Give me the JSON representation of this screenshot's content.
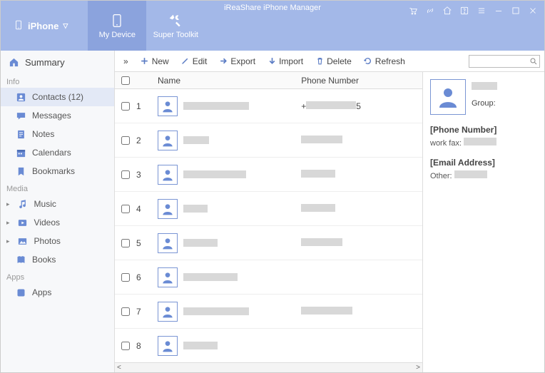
{
  "app_title": "iReaShare iPhone Manager",
  "device_selector": {
    "label": "iPhone"
  },
  "header_tabs": {
    "my_device": "My Device",
    "super_toolkit": "Super Toolkit"
  },
  "sidebar": {
    "summary": "Summary",
    "groups": {
      "info": {
        "label": "Info",
        "items": [
          {
            "label": "Contacts  (12)",
            "icon": "contacts",
            "active": true
          },
          {
            "label": "Messages",
            "icon": "messages"
          },
          {
            "label": "Notes",
            "icon": "notes"
          },
          {
            "label": "Calendars",
            "icon": "calendars"
          },
          {
            "label": "Bookmarks",
            "icon": "bookmarks"
          }
        ]
      },
      "media": {
        "label": "Media",
        "items": [
          {
            "label": "Music",
            "icon": "music",
            "arrow": true
          },
          {
            "label": "Videos",
            "icon": "videos",
            "arrow": true
          },
          {
            "label": "Photos",
            "icon": "photos",
            "arrow": true
          },
          {
            "label": "Books",
            "icon": "books"
          }
        ]
      },
      "apps": {
        "label": "Apps",
        "items": [
          {
            "label": "Apps",
            "icon": "apps"
          }
        ]
      }
    }
  },
  "toolbar": {
    "expand": "»",
    "new": "New",
    "edit": "Edit",
    "export": "Export",
    "import": "Import",
    "delete": "Delete",
    "refresh": "Refresh",
    "search_placeholder": ""
  },
  "table": {
    "columns": {
      "name": "Name",
      "phone": "Phone Number"
    },
    "rows": [
      {
        "idx": "1",
        "name_redact_w": 92,
        "phone_prefix": "+",
        "phone_redact_w": 70,
        "phone_suffix": "5"
      },
      {
        "idx": "2",
        "name_redact_w": 36,
        "phone_redact_w": 58
      },
      {
        "idx": "3",
        "name_redact_w": 88,
        "phone_redact_w": 48
      },
      {
        "idx": "4",
        "name_redact_w": 34,
        "phone_redact_w": 48
      },
      {
        "idx": "5",
        "name_redact_w": 48,
        "phone_redact_w": 58
      },
      {
        "idx": "6",
        "name_redact_w": 76,
        "phone_redact_w": 0
      },
      {
        "idx": "7",
        "name_redact_w": 92,
        "phone_redact_w": 72
      },
      {
        "idx": "8",
        "name_redact_w": 48,
        "phone_redact_w": 0
      }
    ]
  },
  "details": {
    "name_redact_w": 36,
    "group_label": "Group:",
    "phone_section": "[Phone Number]",
    "phone_label": "work fax:",
    "phone_redact_w": 46,
    "email_section": "[Email Address]",
    "email_label": "Other:",
    "email_redact_w": 46
  }
}
